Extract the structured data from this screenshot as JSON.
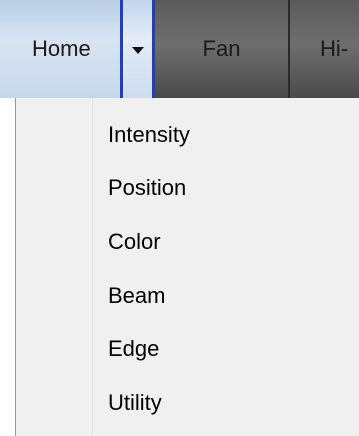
{
  "toolbar": {
    "tabs": [
      {
        "label": "Home"
      },
      {
        "label": "Fan"
      },
      {
        "label": "Hi-"
      }
    ],
    "dropdown_icon": "chevron-down-icon"
  },
  "menu": {
    "items": [
      {
        "label": "Intensity"
      },
      {
        "label": "Position"
      },
      {
        "label": "Color"
      },
      {
        "label": "Beam"
      },
      {
        "label": "Edge"
      },
      {
        "label": "Utility"
      }
    ]
  },
  "colors": {
    "active_tab": "#c7d7ea",
    "toolbar": "#5a5a5a",
    "focus_border": "#1f3fbf",
    "menu_background": "#f0f0f0"
  }
}
